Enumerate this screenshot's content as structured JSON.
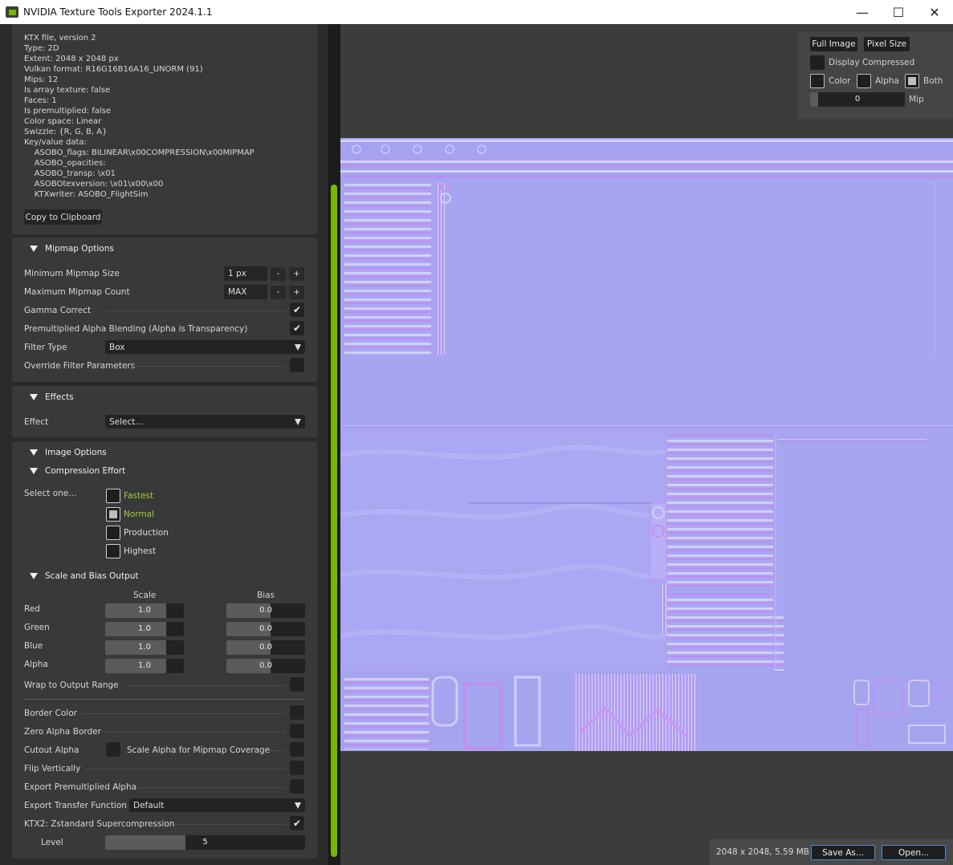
{
  "window": {
    "title": "NVIDIA Texture Tools Exporter 2024.1.1",
    "minimize_glyph": "—",
    "maximize_glyph": "☐",
    "close_glyph": "✕"
  },
  "info": {
    "lines": [
      "KTX file, version 2",
      "Type: 2D",
      "Extent: 2048 x 2048 px",
      "Vulkan format: R16G16B16A16_UNORM (91)",
      "Mips: 12",
      "Is array texture: false",
      "Faces: 1",
      "Is premultiplied: false",
      "Color space: Linear",
      "Swizzle: {R, G, B, A}",
      "Key/value data:",
      "    ASOBO_flags: BILINEAR\\x00COMPRESSION\\x00MIPMAP",
      "    ASOBO_opacities:",
      "    ASOBO_transp: \\x01",
      "    ASOBOtexversion: \\x01\\x00\\x00",
      "    KTXwriter: ASOBO_FlightSim"
    ],
    "copy_button": "Copy to Clipboard"
  },
  "mipmap": {
    "header": "Mipmap Options",
    "min_size_label": "Minimum Mipmap Size",
    "min_size_value": "1 px",
    "max_count_label": "Maximum Mipmap Count",
    "max_count_value": "MAX",
    "minus": "-",
    "plus": "+",
    "gamma_label": "Gamma Correct",
    "gamma_checked": true,
    "premult_label": "Premultiplied Alpha Blending (Alpha is Transparency)",
    "premult_checked": true,
    "filter_label": "Filter Type",
    "filter_value": "Box",
    "override_label": "Override Filter Parameters",
    "override_checked": false,
    "check_glyph": "✔"
  },
  "effects": {
    "header": "Effects",
    "effect_label": "Effect",
    "effect_value": "Select..."
  },
  "image": {
    "header": "Image Options",
    "compression_header": "Compression Effort",
    "select_label": "Select one...",
    "options": [
      "Fastest",
      "Normal",
      "Production",
      "Highest"
    ],
    "selected": "Normal",
    "scale_bias_header": "Scale and Bias Output",
    "scale_col": "Scale",
    "bias_col": "Bias",
    "channels": [
      {
        "name": "Red",
        "scale": "1.0",
        "bias": "0.0"
      },
      {
        "name": "Green",
        "scale": "1.0",
        "bias": "0.0"
      },
      {
        "name": "Blue",
        "scale": "1.0",
        "bias": "0.0"
      },
      {
        "name": "Alpha",
        "scale": "1.0",
        "bias": "0.0"
      }
    ],
    "wrap_label": "Wrap to Output Range",
    "border_color_label": "Border Color",
    "zero_alpha_label": "Zero Alpha Border",
    "cutout_label": "Cutout Alpha",
    "scale_alpha_label": "Scale Alpha for Mipmap Coverage",
    "flip_label": "Flip Vertically",
    "export_premult_label": "Export Premultiplied Alpha",
    "transfer_label": "Export Transfer Function",
    "transfer_value": "Default",
    "ktx2_label": "KTX2: Zstandard Supercompression",
    "ktx2_checked": true,
    "level_label": "Level",
    "level_value": "5"
  },
  "viewer": {
    "full_image": "Full Image",
    "pixel_size": "Pixel Size",
    "display_compressed": "Display Compressed",
    "color": "Color",
    "alpha": "Alpha",
    "both": "Both",
    "mip_value": "0",
    "mip_label": "Mip",
    "accent": "#76b900"
  },
  "footer": {
    "status": "2048 x 2048, 5.59 MB",
    "save_as": "Save As...",
    "open": "Open..."
  }
}
